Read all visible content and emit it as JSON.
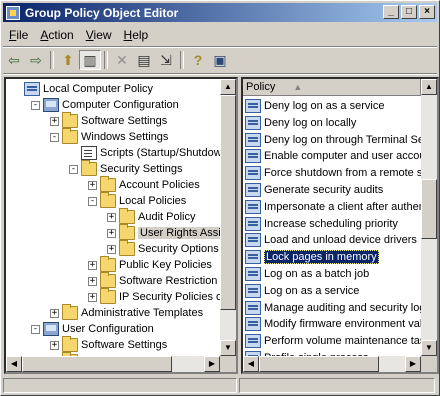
{
  "window": {
    "title": "Group Policy Object Editor"
  },
  "title_buttons": {
    "minimize": "_",
    "maximize": "□",
    "close": "×"
  },
  "menu": [
    {
      "mnemonic": "F",
      "rest": "ile"
    },
    {
      "mnemonic": "A",
      "rest": "ction"
    },
    {
      "mnemonic": "V",
      "rest": "iew"
    },
    {
      "mnemonic": "H",
      "rest": "elp"
    }
  ],
  "toolbar": {
    "icons": [
      "back-arrow-icon",
      "forward-arrow-icon",
      "up-folder-icon",
      "show-hide-tree-icon",
      "delete-icon",
      "properties-icon",
      "export-list-icon",
      "help-icon",
      "show-hide-action-pane-icon"
    ],
    "glyphs": {
      "back": "⇦",
      "forward": "⇨",
      "up": "⬆",
      "tree": "▥",
      "delete": "✕",
      "properties": "▤",
      "export": "⇲",
      "help": "?",
      "action": "▣"
    }
  },
  "tree": [
    {
      "label": "Local Computer Policy",
      "icon": "policy",
      "expander": ""
    },
    {
      "label": "Computer Configuration",
      "icon": "computer",
      "expander": "-"
    },
    {
      "label": "Software Settings",
      "icon": "folder",
      "expander": "+"
    },
    {
      "label": "Windows Settings",
      "icon": "folder",
      "expander": "-"
    },
    {
      "label": "Scripts (Startup/Shutdown)",
      "icon": "doc",
      "expander": ""
    },
    {
      "label": "Security Settings",
      "icon": "folder",
      "expander": "-"
    },
    {
      "label": "Account Policies",
      "icon": "folder",
      "expander": "+"
    },
    {
      "label": "Local Policies",
      "icon": "folder",
      "expander": "-"
    },
    {
      "label": "Audit Policy",
      "icon": "folder",
      "expander": "+"
    },
    {
      "label": "User Rights Assignm",
      "icon": "folder",
      "expander": "+"
    },
    {
      "label": "Security Options",
      "icon": "folder",
      "expander": "+"
    },
    {
      "label": "Public Key Policies",
      "icon": "folder",
      "expander": "+"
    },
    {
      "label": "Software Restriction Po",
      "icon": "folder",
      "expander": "+"
    },
    {
      "label": "IP Security Policies on L",
      "icon": "folder",
      "expander": "+"
    },
    {
      "label": "Administrative Templates",
      "icon": "folder",
      "expander": "+"
    },
    {
      "label": "User Configuration",
      "icon": "computer",
      "expander": "-"
    },
    {
      "label": "Software Settings",
      "icon": "folder",
      "expander": "+"
    },
    {
      "label": "Windows Settings",
      "icon": "folder",
      "expander": "+"
    }
  ],
  "list": {
    "header": "Policy",
    "sort_arrow": "▲",
    "selected_index": 9,
    "items": [
      "Deny log on as a service",
      "Deny log on locally",
      "Deny log on through Terminal Ser",
      "Enable computer and user accour",
      "Force shutdown from a remote sy",
      "Generate security audits",
      "Impersonate a client after authen",
      "Increase scheduling priority",
      "Load and unload device drivers",
      "Lock pages in memory",
      "Log on as a batch job",
      "Log on as a service",
      "Manage auditing and security log",
      "Modify firmware environment valu",
      "Perform volume maintenance task",
      "Profile single process"
    ]
  },
  "scroll": {
    "up": "▲",
    "down": "▼",
    "left": "◀",
    "right": "▶"
  },
  "colors": {
    "title_start": "#0a246a",
    "title_end": "#a6caf0",
    "selection": "#0a246a"
  }
}
